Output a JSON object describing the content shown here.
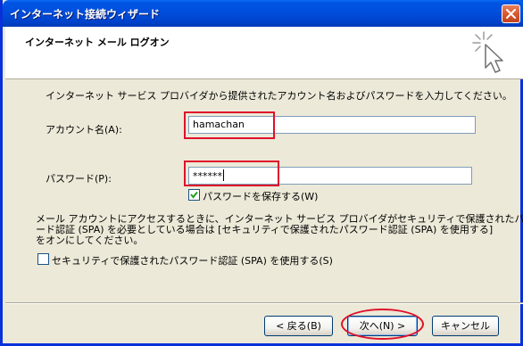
{
  "window": {
    "title": "インターネット接続ウィザード",
    "close_icon": "close-icon"
  },
  "header": {
    "title": "インターネット メール ログオン",
    "icon": "wizard-sparkle-cursor-icon"
  },
  "body": {
    "instruction": "インターネット サービス プロバイダから提供されたアカウント名およびパスワードを入力してください。",
    "account_label": "アカウント名(A):",
    "account_value": "hamachan",
    "password_label": "パスワード(P):",
    "password_value": "******",
    "save_password_label": "パスワードを保存する(W)",
    "save_password_checked": true,
    "spa_paragraph": [
      "メール アカウントにアクセスするときに、インターネット サービス プロバイダがセキュリティで保護されたパスワ",
      "ード認証 (SPA) を必要としている場合は [セキュリティで保護されたパスワード認証 (SPA) を使用する]",
      "をオンにしてください。"
    ],
    "spa_checkbox_label": "セキュリティで保護されたパスワード認証 (SPA) を使用する(S)",
    "spa_checked": false
  },
  "buttons": {
    "back": "< 戻る(B)",
    "next": "次へ(N) >",
    "cancel": "キャンセル"
  },
  "colors": {
    "titlebar": "#0050de",
    "highlight_annotation": "#e0102a",
    "dialog_bg": "#ece9d8"
  }
}
